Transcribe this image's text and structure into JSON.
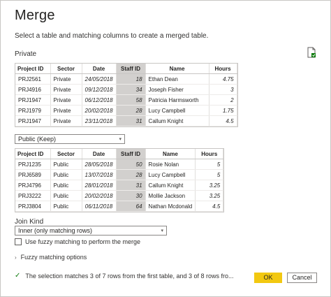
{
  "dialog": {
    "title": "Merge",
    "subtitle": "Select a table and matching columns to create a merged table."
  },
  "first_table": {
    "label": "Private",
    "columns": [
      "Project ID",
      "Sector",
      "Date",
      "Staff ID",
      "Name",
      "Hours"
    ],
    "selected_column": "Staff ID",
    "rows": [
      [
        "PRJ2561",
        "Private",
        "24/05/2018",
        "18",
        "Ethan Dean",
        "4.75"
      ],
      [
        "PRJ4916",
        "Private",
        "09/12/2018",
        "34",
        "Joseph Fisher",
        "3"
      ],
      [
        "PRJ1947",
        "Private",
        "06/12/2018",
        "58",
        "Patricia Harmsworth",
        "2"
      ],
      [
        "PRJ1979",
        "Private",
        "20/02/2018",
        "28",
        "Lucy Campbell",
        "1.75"
      ],
      [
        "PRJ1947",
        "Private",
        "23/11/2018",
        "31",
        "Callum Knight",
        "4.5"
      ]
    ]
  },
  "second_table": {
    "dropdown_value": "Public (Keep)",
    "columns": [
      "Project ID",
      "Sector",
      "Date",
      "Staff ID",
      "Name",
      "Hours"
    ],
    "selected_column": "Staff ID",
    "rows": [
      [
        "PRJ1235",
        "Public",
        "28/05/2018",
        "50",
        "Rosie Nolan",
        "5"
      ],
      [
        "PRJ6589",
        "Public",
        "13/07/2018",
        "28",
        "Lucy Campbell",
        "5"
      ],
      [
        "PRJ4796",
        "Public",
        "28/01/2018",
        "31",
        "Callum Knight",
        "3.25"
      ],
      [
        "PRJ3222",
        "Public",
        "20/02/2018",
        "30",
        "Mollie Jackson",
        "3.25"
      ],
      [
        "PRJ3804",
        "Public",
        "06/11/2018",
        "64",
        "Nathan Mcdonald",
        "4.5"
      ]
    ]
  },
  "join": {
    "label": "Join Kind",
    "value": "Inner (only matching rows)",
    "fuzzy_checkbox_label": "Use fuzzy matching to perform the merge",
    "fuzzy_checked": false,
    "fuzzy_options_label": "Fuzzy matching options"
  },
  "status": {
    "text": "The selection matches 3 of 7 rows from the first table, and 3 of 8 rows fro..."
  },
  "buttons": {
    "ok": "OK",
    "cancel": "Cancel"
  },
  "colors": {
    "ok_button": "#f2c811",
    "selected_column": "#d2d0ce",
    "status_check": "#107c10"
  },
  "icons": {
    "file": "file-icon",
    "check": "checkmark-icon",
    "chevron": "chevron-right-icon",
    "caret": "chevron-down-icon"
  }
}
